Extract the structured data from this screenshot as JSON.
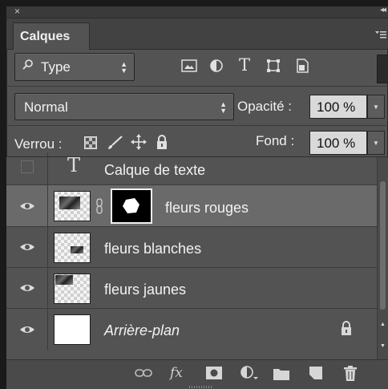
{
  "panel": {
    "close_glyph": "×",
    "collapse_glyph": "◂◂",
    "tab_title": "Calques",
    "menu_glyph": "☰"
  },
  "filter": {
    "type_label": "Type",
    "search_glyph": "⌕",
    "icons": [
      "image-filter-icon",
      "adjustment-filter-icon",
      "text-filter-icon",
      "shape-filter-icon",
      "smart-object-filter-icon"
    ],
    "text_icon_glyph": "T"
  },
  "blend": {
    "mode": "Normal",
    "opacity_label": "Opacité :",
    "opacity_value": "100 %"
  },
  "lock": {
    "label": "Verrou :",
    "fill_label": "Fond :",
    "fill_value": "100 %",
    "icons": [
      "lock-transparent-pixels-icon",
      "lock-image-pixels-icon",
      "lock-position-icon",
      "lock-all-icon"
    ]
  },
  "layers": [
    {
      "name": "Calque de texte",
      "visible": false,
      "kind": "text",
      "thumb_glyph": "T"
    },
    {
      "name": "fleurs rouges",
      "visible": true,
      "kind": "image-with-mask",
      "selected": true
    },
    {
      "name": "fleurs blanches",
      "visible": true,
      "kind": "image"
    },
    {
      "name": "fleurs jaunes",
      "visible": true,
      "kind": "image"
    },
    {
      "name": "Arrière-plan",
      "visible": true,
      "kind": "background",
      "locked": true
    }
  ],
  "footer": {
    "link_glyph": "⊖",
    "fx_label": "fx",
    "icons": [
      "link-layers-icon",
      "layer-style-icon",
      "add-mask-icon",
      "new-adjustment-layer-icon",
      "new-group-icon",
      "new-layer-icon",
      "delete-layer-icon"
    ]
  }
}
